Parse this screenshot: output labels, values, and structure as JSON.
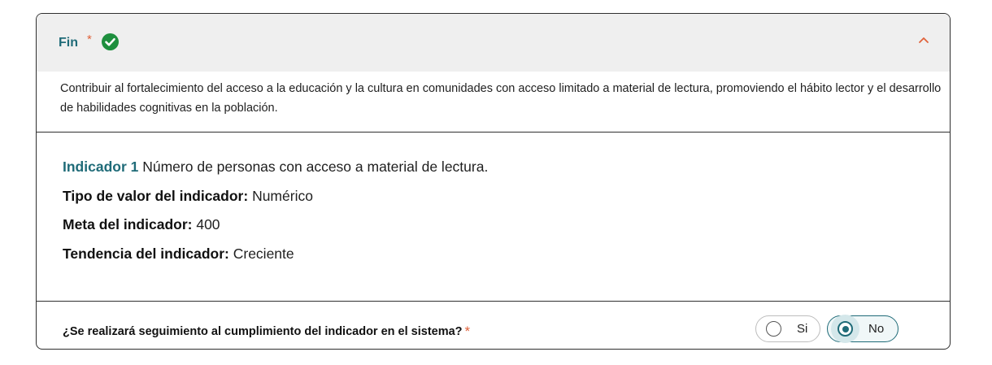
{
  "section": {
    "title": "Fin",
    "required_mark": "*",
    "status_icon": "check-circle-icon",
    "collapse_icon": "chevron-up-icon",
    "description": "Contribuir al fortalecimiento del acceso a la educación y la cultura en comunidades con acceso limitado a material de lectura, promoviendo el hábito lector y el desarrollo de habilidades cognitivas en la población."
  },
  "indicator": {
    "title": "Indicador 1",
    "name": "Número de personas con acceso a material de lectura.",
    "value_type_label": "Tipo de valor del indicador:",
    "value_type": "Numérico",
    "goal_label": "Meta del indicador:",
    "goal": "400",
    "trend_label": "Tendencia del indicador:",
    "trend": "Creciente"
  },
  "tracking": {
    "question": "¿Se realizará seguimiento al cumplimiento del indicador en el sistema?",
    "required_mark": "*",
    "options": [
      {
        "label": "Si",
        "selected": false
      },
      {
        "label": "No",
        "selected": true
      }
    ]
  },
  "colors": {
    "accent": "#1f6b78",
    "required": "#e0623a",
    "success": "#1e8f3e",
    "header_bg": "#efefef"
  }
}
